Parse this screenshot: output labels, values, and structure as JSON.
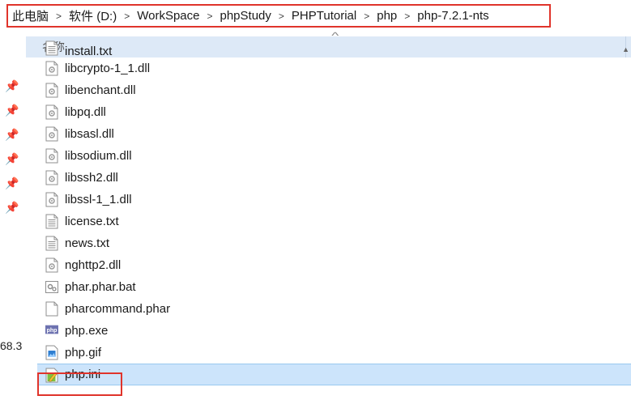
{
  "breadcrumb": [
    "此电脑",
    "软件 (D:)",
    "WorkSpace",
    "phpStudy",
    "PHPTutorial",
    "php",
    "php-7.2.1-nts"
  ],
  "header": {
    "name_col": "名称"
  },
  "side_text": "68.3",
  "files": [
    {
      "name": "install.txt",
      "icon": "text-file-icon"
    },
    {
      "name": "libcrypto-1_1.dll",
      "icon": "dll-file-icon"
    },
    {
      "name": "libenchant.dll",
      "icon": "dll-file-icon"
    },
    {
      "name": "libpq.dll",
      "icon": "dll-file-icon"
    },
    {
      "name": "libsasl.dll",
      "icon": "dll-file-icon"
    },
    {
      "name": "libsodium.dll",
      "icon": "dll-file-icon"
    },
    {
      "name": "libssh2.dll",
      "icon": "dll-file-icon"
    },
    {
      "name": "libssl-1_1.dll",
      "icon": "dll-file-icon"
    },
    {
      "name": "license.txt",
      "icon": "text-file-icon"
    },
    {
      "name": "news.txt",
      "icon": "text-file-icon"
    },
    {
      "name": "nghttp2.dll",
      "icon": "dll-file-icon"
    },
    {
      "name": "phar.phar.bat",
      "icon": "batch-file-icon"
    },
    {
      "name": "pharcommand.phar",
      "icon": "blank-file-icon"
    },
    {
      "name": "php.exe",
      "icon": "php-exe-icon"
    },
    {
      "name": "php.gif",
      "icon": "image-file-icon"
    },
    {
      "name": "php.ini",
      "icon": "ini-file-icon"
    }
  ],
  "selected_file": "php.ini",
  "colors": {
    "highlight_border": "#e0342b",
    "selection_bg": "#cce4fb",
    "header_bg": "#dde9f7"
  }
}
